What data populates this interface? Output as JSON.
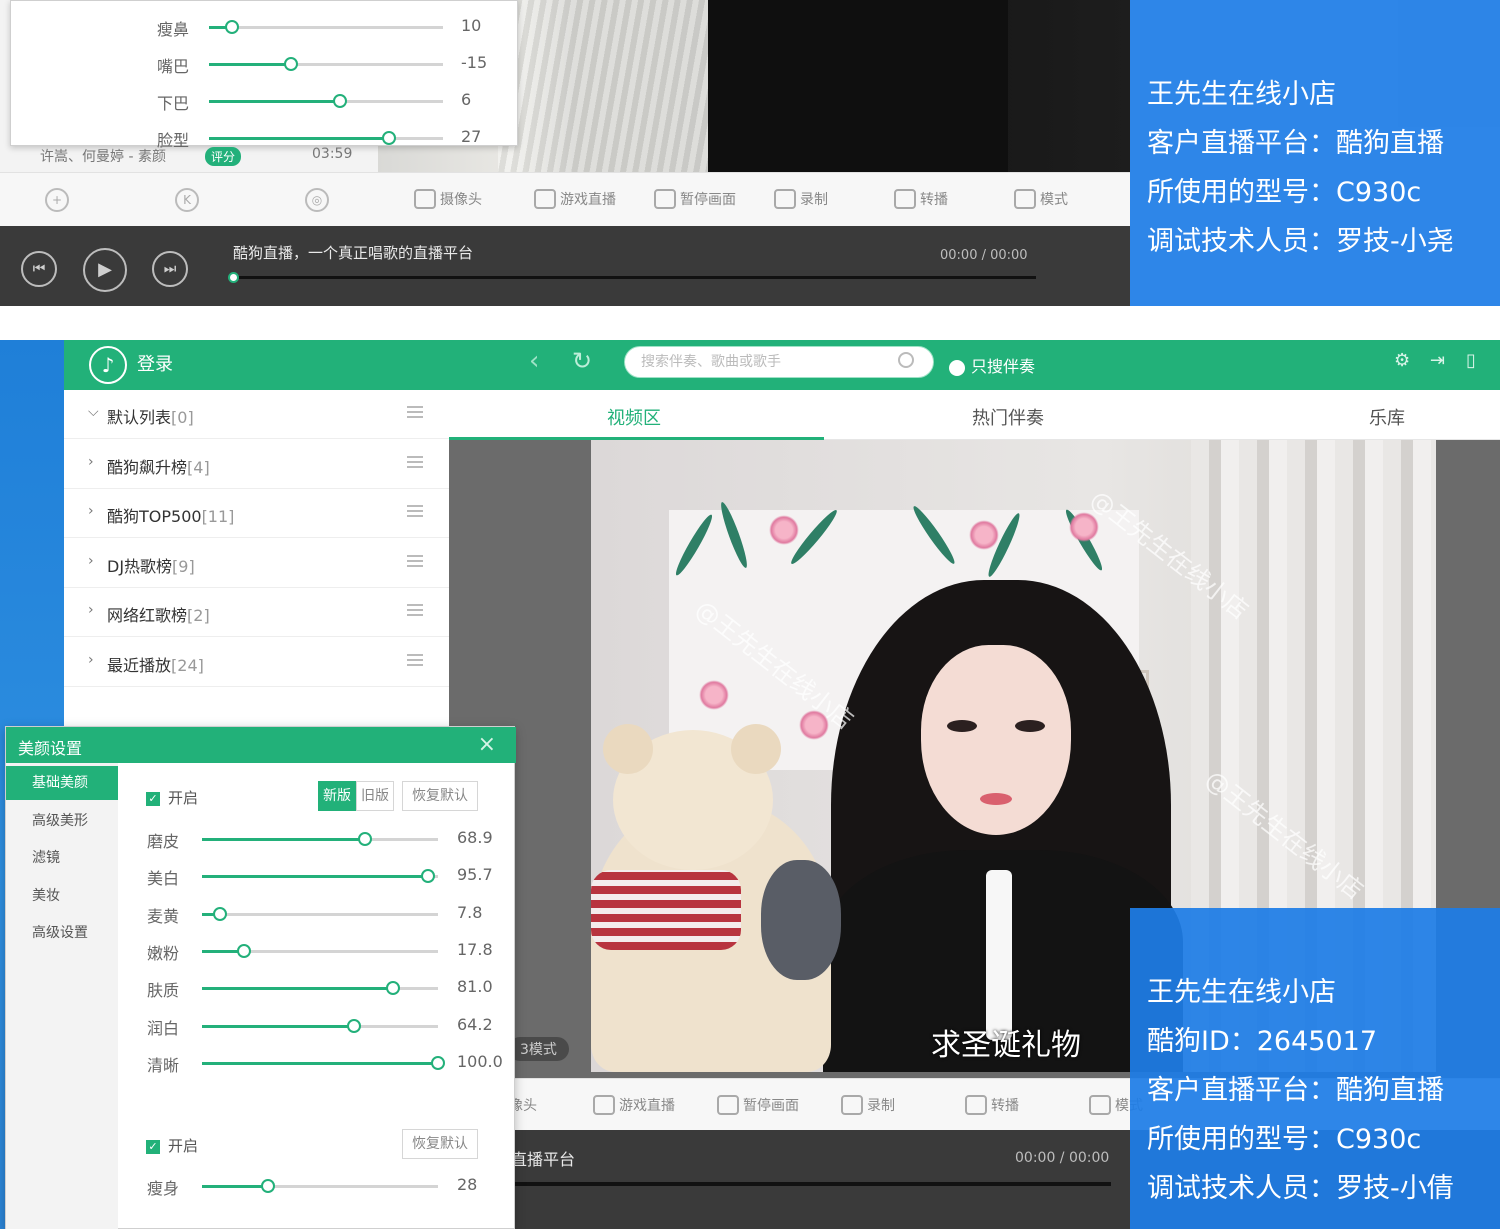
{
  "top": {
    "beauty_sliders": [
      {
        "label": "瘦鼻",
        "value": "10",
        "fraction": 0.1
      },
      {
        "label": "嘴巴",
        "value": "-15",
        "fraction": 0.35
      },
      {
        "label": "下巴",
        "value": "6",
        "fraction": 0.56
      },
      {
        "label": "脸型",
        "value": "27",
        "fraction": 0.77
      }
    ],
    "song": "许嵩、何曼婷 - 素颜",
    "badge": "评分",
    "duration": "03:59",
    "toolbar": [
      "摄像头",
      "游戏直播",
      "暂停画面",
      "录制",
      "转播",
      "模式"
    ],
    "player_title": "酷狗直播，一个真正唱歌的直播平台",
    "player_time": "00:00 / 00:00",
    "info": [
      "王先生在线小店",
      "客户直播平台：酷狗直播",
      "所使用的型号：C930c",
      "调试技术人员：罗技-小尧"
    ]
  },
  "bottom": {
    "login": "登录",
    "search_placeholder": "搜索伴奏、歌曲或歌手",
    "only_accomp": "只搜伴奏",
    "playlists": [
      {
        "name": "默认列表",
        "count": "[0]",
        "chev": "⌵"
      },
      {
        "name": "酷狗飙升榜",
        "count": "[4]",
        "chev": "›"
      },
      {
        "name": "酷狗TOP500",
        "count": "[11]",
        "chev": "›"
      },
      {
        "name": "DJ热歌榜",
        "count": "[9]",
        "chev": "›"
      },
      {
        "name": "网络红歌榜",
        "count": "[2]",
        "chev": "›"
      },
      {
        "name": "最近播放",
        "count": "[24]",
        "chev": "›"
      }
    ],
    "tabs": [
      "视频区",
      "热门伴奏",
      "乐库"
    ],
    "gift_text": "求圣诞礼物",
    "watermark": "@王先生在线小店",
    "mode_pill": "3模式",
    "toolbar": [
      "摄像头",
      "游戏直播",
      "暂停画面",
      "录制",
      "转播",
      "模式"
    ],
    "player_title": "直播平台",
    "player_time": "00:00 / 00:00",
    "info": [
      "王先生在线小店",
      "酷狗ID：2645017",
      "客户直播平台：酷狗直播",
      "所使用的型号：C930c",
      "调试技术人员：罗技-小倩"
    ],
    "beauty": {
      "title": "美颜设置",
      "side": [
        "基础美颜",
        "高级美形",
        "滤镜",
        "美妆",
        "高级设置"
      ],
      "enable": "开启",
      "seg_new": "新版",
      "seg_old": "旧版",
      "restore": "恢复默认",
      "sliders": [
        {
          "label": "磨皮",
          "value": "68.9",
          "fraction": 0.689
        },
        {
          "label": "美白",
          "value": "95.7",
          "fraction": 0.957
        },
        {
          "label": "麦黄",
          "value": "7.8",
          "fraction": 0.078
        },
        {
          "label": "嫩粉",
          "value": "17.8",
          "fraction": 0.178
        },
        {
          "label": "肤质",
          "value": "81.0",
          "fraction": 0.81
        },
        {
          "label": "润白",
          "value": "64.2",
          "fraction": 0.642
        },
        {
          "label": "清晰",
          "value": "100.0",
          "fraction": 1.0
        }
      ],
      "enable2": "开启",
      "restore2": "恢复默认",
      "slim": {
        "label": "瘦身",
        "value": "28",
        "fraction": 0.28
      }
    }
  },
  "colors": {
    "accent": "#22b179",
    "info_box": "#1e7de6",
    "player": "#3a3a3a"
  }
}
